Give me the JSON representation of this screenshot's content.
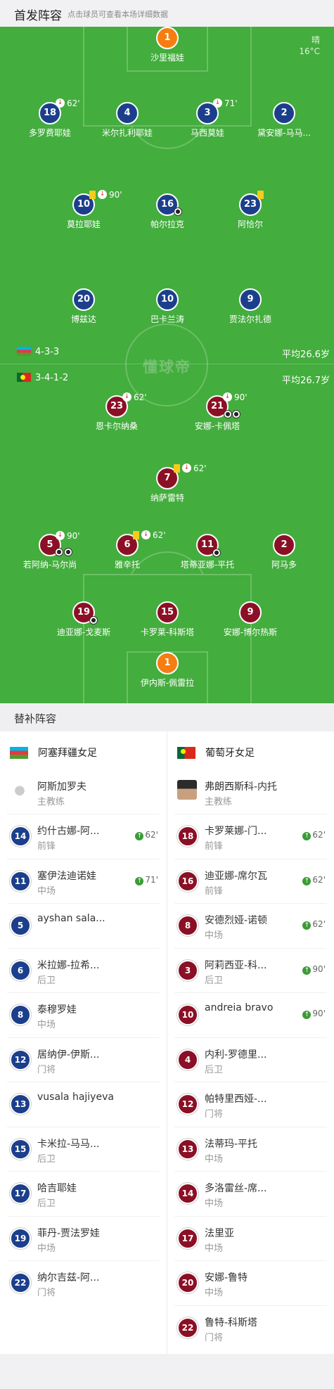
{
  "header": {
    "title": "首发阵容",
    "hint": "点击球员可查看本场详细数据"
  },
  "weather": {
    "condition": "晴",
    "temp": "16°C"
  },
  "watermark": "懂球帝",
  "formation": {
    "home": "4-3-3",
    "away": "3-4-1-2",
    "home_avg": "平均26.6岁",
    "away_avg": "平均26.7岁"
  },
  "home_players": [
    {
      "num": "1",
      "name": "沙里福娃"
    },
    {
      "num": "18",
      "name": "多罗费耶娃",
      "sub_min": "62'"
    },
    {
      "num": "4",
      "name": "米尔扎利耶娃"
    },
    {
      "num": "3",
      "name": "马西莫娃",
      "sub_min": "71'"
    },
    {
      "num": "2",
      "name": "黛安娜-马马..."
    },
    {
      "num": "10",
      "name": "莫拉耶娃",
      "sub_min": "90'"
    },
    {
      "num": "16",
      "name": "帕尔拉克"
    },
    {
      "num": "23",
      "name": "阿恰尔"
    },
    {
      "num": "20",
      "name": "博兹达"
    },
    {
      "num": "10",
      "name": "巴卡兰涛"
    },
    {
      "num": "9",
      "name": "贾法尔扎德"
    }
  ],
  "away_players": [
    {
      "num": "23",
      "name": "恩卡尔纳桑",
      "sub_min": "62'"
    },
    {
      "num": "21",
      "name": "安娜-卡佩塔",
      "sub_min": "90'"
    },
    {
      "num": "7",
      "name": "纳萨雷特",
      "sub_min": "62'"
    },
    {
      "num": "5",
      "name": "若阿纳-马尔尚",
      "sub_min": "90'"
    },
    {
      "num": "6",
      "name": "雅辛托",
      "sub_min": "62'"
    },
    {
      "num": "11",
      "name": "塔蒂亚娜-平托"
    },
    {
      "num": "2",
      "name": "阿马多"
    },
    {
      "num": "19",
      "name": "迪亚娜-戈麦斯"
    },
    {
      "num": "15",
      "name": "卡罗莱-科斯塔"
    },
    {
      "num": "9",
      "name": "安娜-博尔热斯"
    },
    {
      "num": "1",
      "name": "伊内斯-佩雷拉"
    }
  ],
  "subs_title": "替补阵容",
  "home_team": {
    "name": "阿塞拜疆女足",
    "coach": "阿斯加罗夫",
    "coach_role": "主教练"
  },
  "away_team": {
    "name": "葡萄牙女足",
    "coach": "弗朗西斯科-内托",
    "coach_role": "主教练"
  },
  "home_subs": [
    {
      "num": "14",
      "name": "约什古娜-阿...",
      "pos": "前锋",
      "in": "62'"
    },
    {
      "num": "11",
      "name": "塞伊法迪诺娃",
      "pos": "中场",
      "in": "71'"
    },
    {
      "num": "5",
      "name": "ayshan sala...",
      "pos": ""
    },
    {
      "num": "6",
      "name": "米拉娜-拉希...",
      "pos": "后卫"
    },
    {
      "num": "8",
      "name": "泰穆罗娃",
      "pos": "中场"
    },
    {
      "num": "12",
      "name": "居纳伊-伊斯...",
      "pos": "门将"
    },
    {
      "num": "13",
      "name": "vusala hajiyeva",
      "pos": ""
    },
    {
      "num": "15",
      "name": "卡米拉-马马...",
      "pos": "后卫"
    },
    {
      "num": "17",
      "name": "哈吉耶娃",
      "pos": "后卫"
    },
    {
      "num": "19",
      "name": "菲丹-贾法罗娃",
      "pos": "中场"
    },
    {
      "num": "22",
      "name": "纳尔吉兹-阿...",
      "pos": "门将"
    }
  ],
  "away_subs": [
    {
      "num": "18",
      "name": "卡罗莱娜-门...",
      "pos": "前锋",
      "in": "62'"
    },
    {
      "num": "16",
      "name": "迪亚娜-席尔瓦",
      "pos": "前锋",
      "in": "62'"
    },
    {
      "num": "8",
      "name": "安德烈娅-诺顿",
      "pos": "中场",
      "in": "62'"
    },
    {
      "num": "3",
      "name": "阿莉西亚-科...",
      "pos": "后卫",
      "in": "90'"
    },
    {
      "num": "10",
      "name": "andreia bravo",
      "pos": "",
      "in": "90'"
    },
    {
      "num": "4",
      "name": "内利-罗德里...",
      "pos": "后卫"
    },
    {
      "num": "12",
      "name": "帕特里西娅-...",
      "pos": "门将"
    },
    {
      "num": "13",
      "name": "法蒂玛-平托",
      "pos": "中场"
    },
    {
      "num": "14",
      "name": "多洛雷丝-席...",
      "pos": "中场"
    },
    {
      "num": "17",
      "name": "法里亚",
      "pos": "中场"
    },
    {
      "num": "20",
      "name": "安娜-鲁特",
      "pos": "中场"
    },
    {
      "num": "22",
      "name": "鲁特-科斯塔",
      "pos": "门将"
    }
  ],
  "colors": {
    "pitch": "#43ad3d",
    "home": "#1c3f8c",
    "away": "#8b1025",
    "gk": "#f57d12"
  }
}
